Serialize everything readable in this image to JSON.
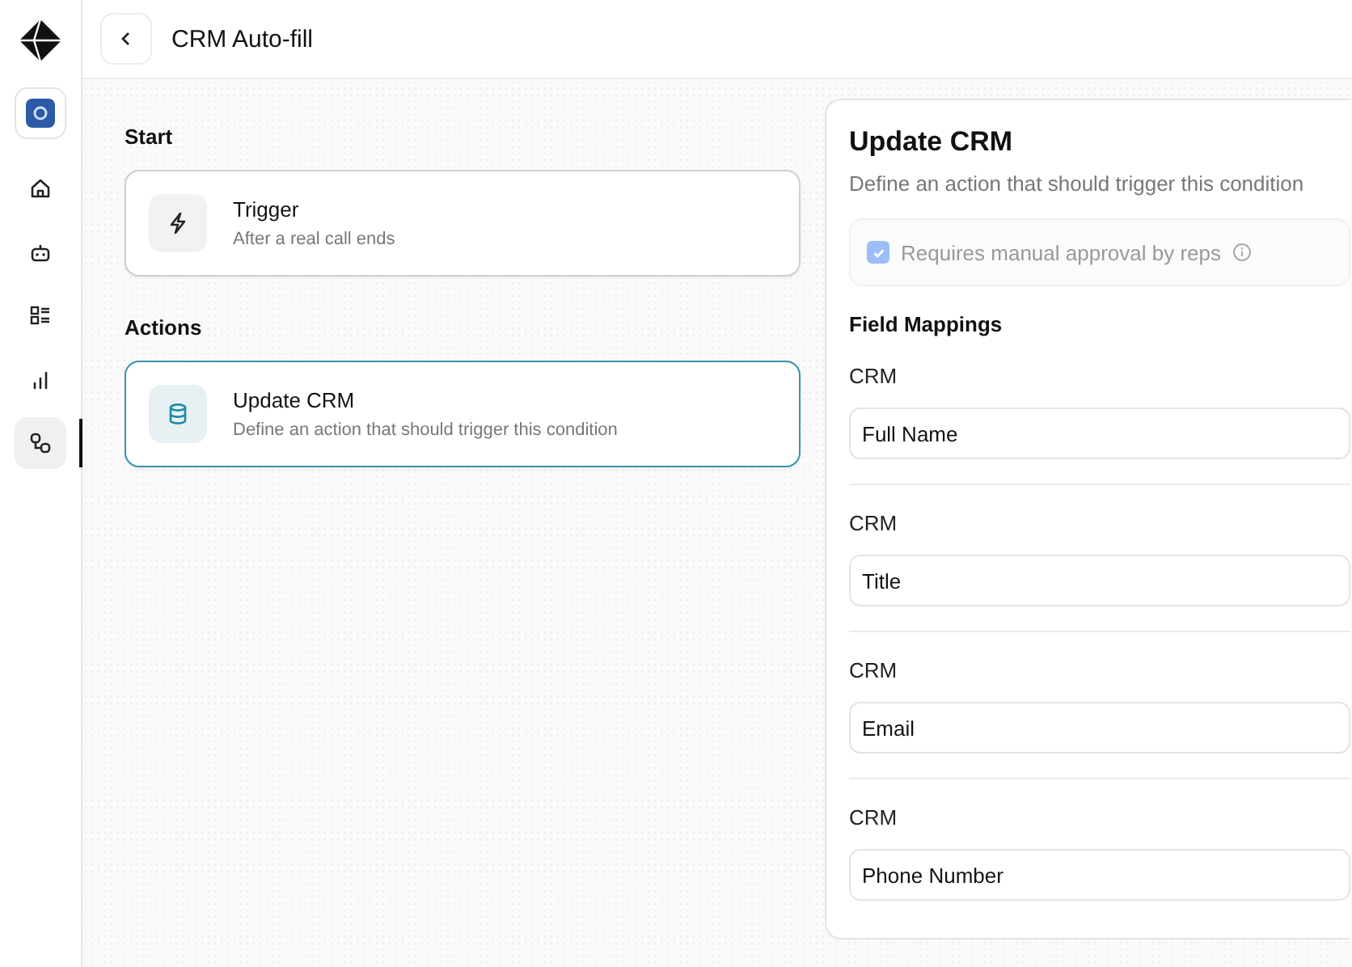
{
  "sidebar": {
    "items": [
      {
        "kind": "workspace",
        "selected": false
      },
      {
        "kind": "home",
        "selected": false
      },
      {
        "kind": "bot",
        "selected": false
      },
      {
        "kind": "list",
        "selected": false
      },
      {
        "kind": "chart",
        "selected": false
      },
      {
        "kind": "flow",
        "selected": true
      }
    ]
  },
  "header": {
    "title": "CRM Auto-fill"
  },
  "sections": [
    {
      "heading": "Start",
      "cards": [
        {
          "kind": "trigger",
          "title": "Trigger",
          "subtitle": "After a real call ends",
          "selected": false
        }
      ]
    },
    {
      "heading": "Actions",
      "cards": [
        {
          "kind": "database",
          "title": "Update CRM",
          "subtitle": "Define an action that should trigger this condition",
          "selected": true
        }
      ]
    }
  ],
  "panel": {
    "title": "Update CRM",
    "description": "Define an action that should trigger this condition",
    "approval": {
      "label": "Requires manual approval by reps",
      "checked": true,
      "disabled": true
    },
    "mappings_heading": "Field Mappings",
    "mappings": [
      {
        "label": "CRM",
        "value": "Full Name"
      },
      {
        "label": "CRM",
        "value": "Title"
      },
      {
        "label": "CRM",
        "value": "Email"
      },
      {
        "label": "CRM",
        "value": "Phone Number"
      }
    ]
  }
}
